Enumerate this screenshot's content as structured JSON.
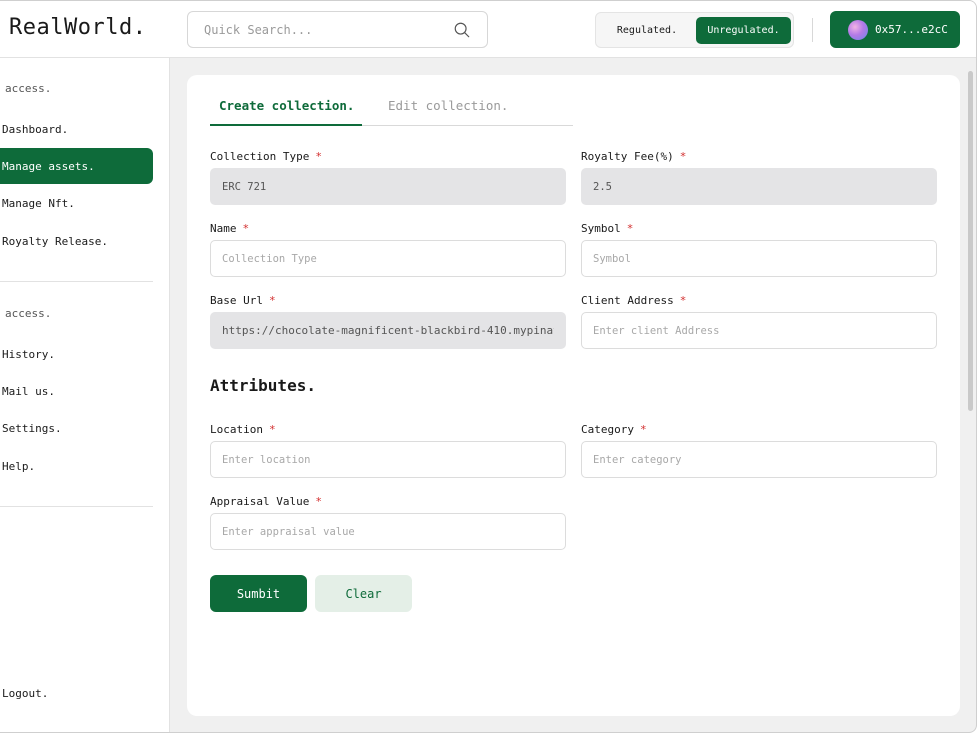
{
  "header": {
    "logo": "RealWorld.",
    "search_placeholder": "Quick Search...",
    "toggle": {
      "regulated": "Regulated.",
      "unregulated": "Unregulated.",
      "selected": "Unregulated."
    },
    "wallet_label": "0x57...e2cC"
  },
  "sidebar": {
    "section1_label": "access.",
    "items1": [
      {
        "label": "Dashboard.",
        "active": false
      },
      {
        "label": "Manage assets.",
        "active": true
      },
      {
        "label": "Manage Nft.",
        "active": false
      },
      {
        "label": "Royalty Release.",
        "active": false
      }
    ],
    "section2_label": "access.",
    "items2": [
      {
        "label": "History."
      },
      {
        "label": "Mail us."
      },
      {
        "label": "Settings."
      },
      {
        "label": "Help."
      }
    ],
    "logout": "Logout."
  },
  "tabs": {
    "create": "Create collection.",
    "edit": "Edit collection."
  },
  "form": {
    "collection_type": {
      "label": "Collection Type",
      "value": "ERC 721"
    },
    "royalty_fee": {
      "label": "Royalty Fee(%)",
      "value": "2.5"
    },
    "name": {
      "label": "Name",
      "placeholder": "Collection Type"
    },
    "symbol": {
      "label": "Symbol",
      "placeholder": "Symbol"
    },
    "base_url": {
      "label": "Base Url",
      "value": "https://chocolate-magnificent-blackbird-410.mypinata"
    },
    "client_address": {
      "label": "Client Address",
      "placeholder": "Enter client Address"
    },
    "required_mark": "*"
  },
  "attributes": {
    "title": "Attributes.",
    "location": {
      "label": "Location",
      "placeholder": "Enter location"
    },
    "category": {
      "label": "Category",
      "placeholder": "Enter category"
    },
    "appraisal_value": {
      "label": "Appraisal Value",
      "placeholder": "Enter appraisal value"
    }
  },
  "buttons": {
    "submit": "Sumbit",
    "clear": "Clear"
  },
  "colors": {
    "accent": "#0e6b3a",
    "required": "#d32f2f"
  }
}
